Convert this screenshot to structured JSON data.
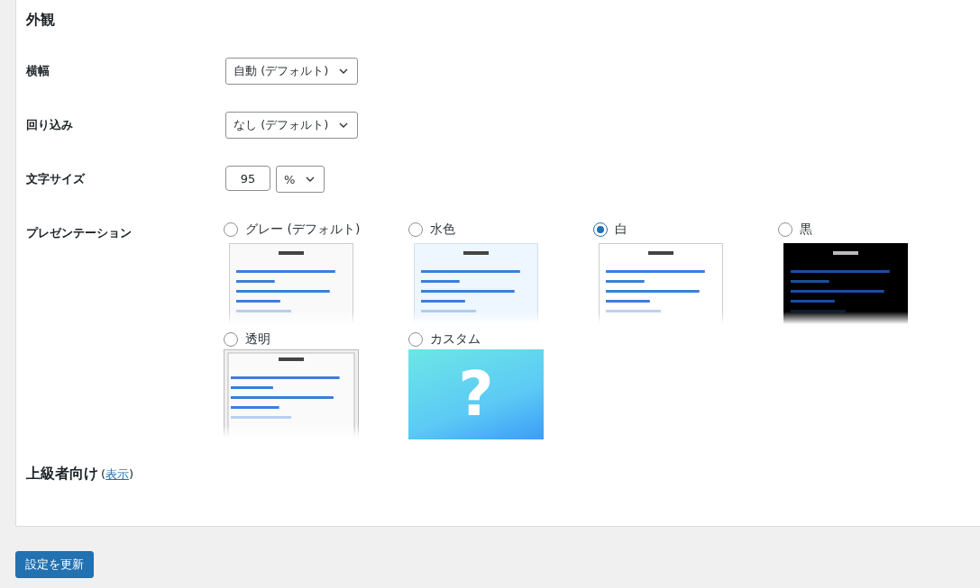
{
  "section_title": "外観",
  "fields": [
    {
      "kind": "select",
      "label": "横幅",
      "value": "自動 (デフォルト)"
    },
    {
      "kind": "select",
      "label": "回り込み",
      "value": "なし (デフォルト)"
    },
    {
      "kind": "size",
      "label": "文字サイズ",
      "value": "95",
      "unit": "%"
    }
  ],
  "presentation": {
    "label": "プレゼンテーション",
    "options": [
      {
        "label": "グレー (デフォルト)",
        "selected": false,
        "kind": "gray"
      },
      {
        "label": "水色",
        "selected": false,
        "kind": "blue"
      },
      {
        "label": "白",
        "selected": true,
        "kind": "white"
      },
      {
        "label": "黒",
        "selected": false,
        "kind": "black"
      },
      {
        "label": "透明",
        "selected": false,
        "kind": "transparent"
      },
      {
        "label": "カスタム",
        "selected": false,
        "kind": "custom",
        "mark": "?"
      }
    ]
  },
  "advanced": {
    "title": "上級者向け",
    "open": "(",
    "link": "表示",
    "close": ")"
  },
  "submit": "設定を更新"
}
